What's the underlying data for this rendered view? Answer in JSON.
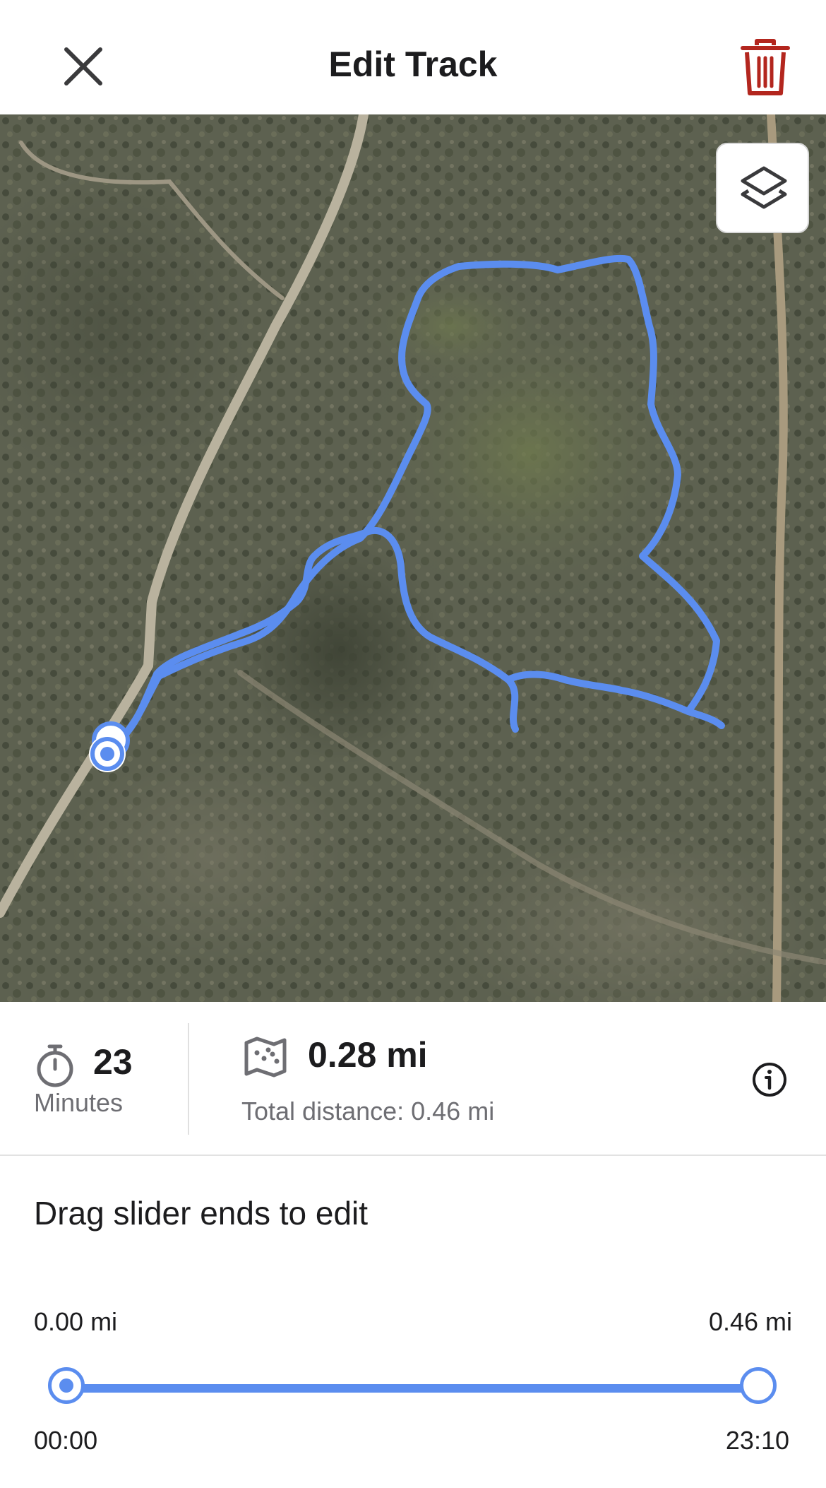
{
  "header": {
    "title": "Edit Track",
    "close_icon": "close-icon",
    "delete_icon": "trash-icon",
    "delete_color": "#b3261e"
  },
  "map": {
    "layers_icon": "layers-icon",
    "track_color": "#5b8def"
  },
  "stats": {
    "duration_value": "23",
    "duration_unit": "Minutes",
    "duration_icon": "timer-icon",
    "distance_value": "0.28 mi",
    "distance_icon": "map-icon",
    "total_distance": "Total distance: 0.46 mi",
    "info_icon": "info-icon"
  },
  "editor": {
    "instruction": "Drag slider ends to edit",
    "start_distance": "0.00 mi",
    "end_distance": "0.46 mi",
    "start_time": "00:00",
    "end_time": "23:10",
    "range_start_fraction": 0.0,
    "range_end_fraction": 1.0,
    "accent": "#5b8def"
  }
}
